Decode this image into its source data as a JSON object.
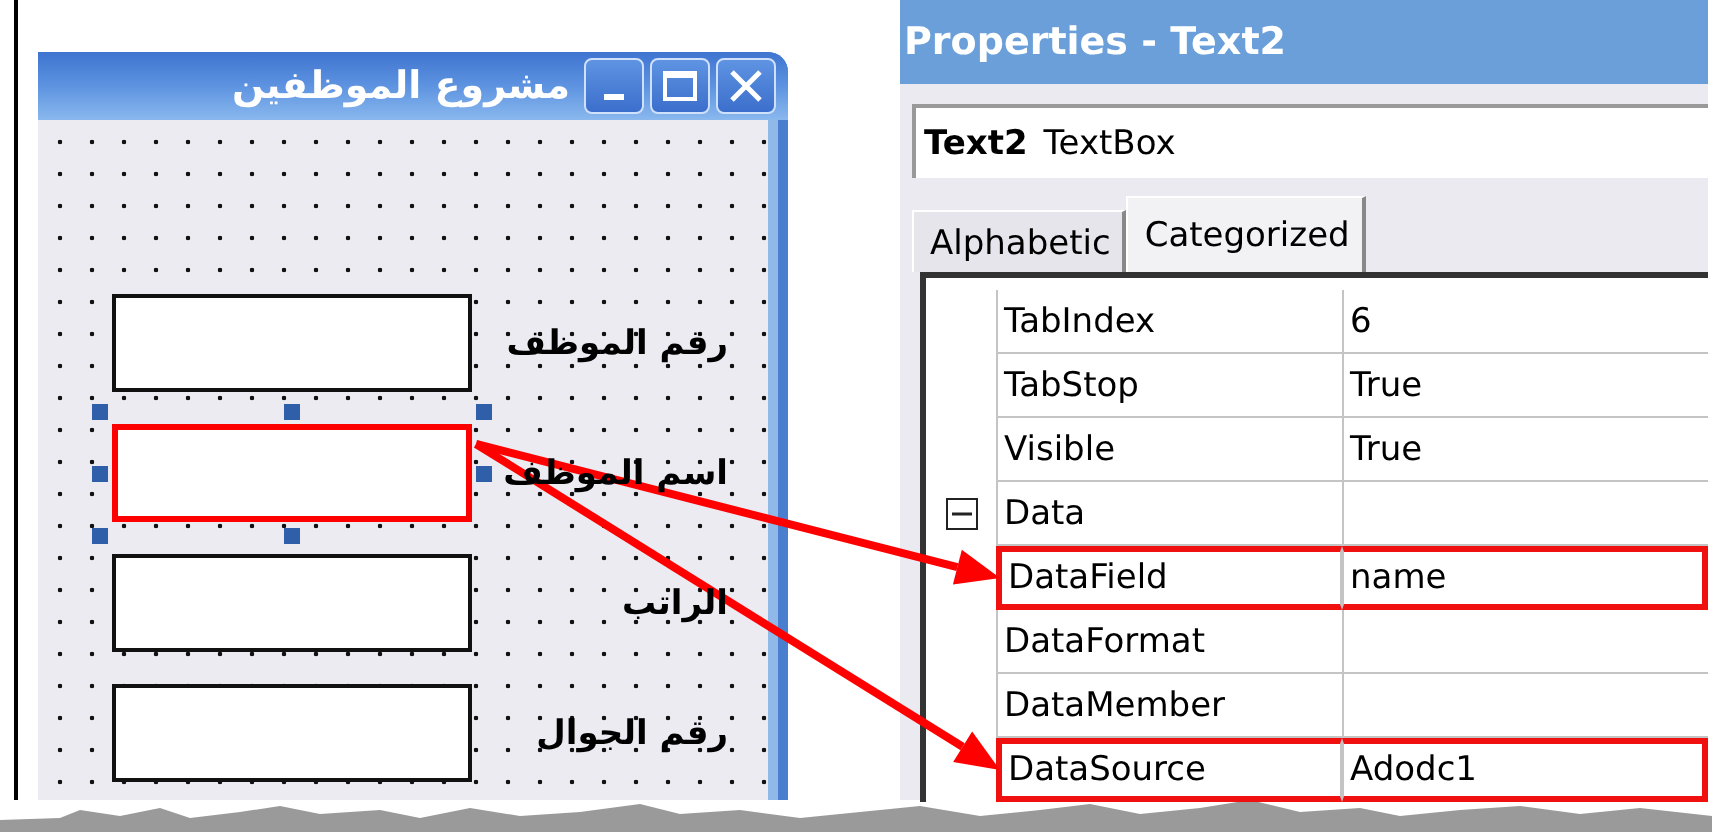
{
  "form": {
    "title": "مشروع الموظفين",
    "fields": [
      {
        "label": "رقم الموظف",
        "selected": false
      },
      {
        "label": "اسم الموظف",
        "selected": true
      },
      {
        "label": "الراتب",
        "selected": false
      },
      {
        "label": "رقم الجوال",
        "selected": false
      }
    ]
  },
  "properties": {
    "title": "Properties - Text2",
    "object": {
      "name": "Text2",
      "type": "TextBox"
    },
    "tabs": [
      {
        "label": "Alphabetic",
        "selected": false
      },
      {
        "label": "Categorized",
        "selected": true
      }
    ],
    "rows": [
      {
        "kind": "property",
        "name": "TabIndex",
        "value": "6",
        "highlighted": false
      },
      {
        "kind": "property",
        "name": "TabStop",
        "value": "True",
        "highlighted": false
      },
      {
        "kind": "property",
        "name": "Visible",
        "value": "True",
        "highlighted": false
      },
      {
        "kind": "category",
        "name": "Data",
        "expanded": true
      },
      {
        "kind": "property",
        "name": "DataField",
        "value": "name",
        "highlighted": true
      },
      {
        "kind": "property",
        "name": "DataFormat",
        "highlighted": false
      },
      {
        "kind": "property",
        "name": "DataMember",
        "highlighted": false
      },
      {
        "kind": "property",
        "name": "DataSource",
        "value": "Adodc1",
        "highlighted": true
      }
    ]
  }
}
